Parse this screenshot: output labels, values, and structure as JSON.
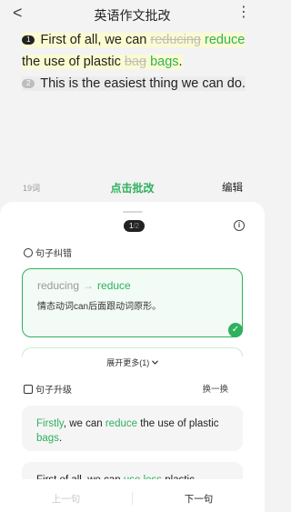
{
  "nav": {
    "back_glyph": "<",
    "title": "英语作文批改",
    "more_glyph": "⋮"
  },
  "essay": {
    "s1_num": "1",
    "s1_a": "First of all, we can ",
    "s1_del1": "reducing",
    "s1_ins1": "reduce",
    "s1_b": " the use of plastic ",
    "s1_del2": "bag",
    "s1_ins2": "bags",
    "s1_c": ".",
    "s2_num": "2",
    "s2_text": "This is the easiest thing we can do."
  },
  "bar": {
    "word_count": "19词",
    "check_label": "点击批改",
    "edit_label": "编辑"
  },
  "sheet": {
    "page_current": "1",
    "page_total": "/2",
    "info_glyph": "i",
    "section_correction": "句子纠错",
    "correction": {
      "from": "reducing",
      "arrow": "→",
      "to": "reduce",
      "explanation": "情态动词can后面跟动词原形。",
      "tick": "✓"
    },
    "expand_label": "展开更多(1)",
    "expand_icon": "chevron-down-icon",
    "section_upgrade": "句子升级",
    "swap_label": "换一换",
    "upgrade1": {
      "p1": "Firstly",
      "p2": ", we can ",
      "p3": "reduce",
      "p4": " the use of plastic ",
      "p5": "bags",
      "p6": "."
    },
    "upgrade2": {
      "p1": "First of all, we can ",
      "p2": "use less",
      "p3": " plastic"
    }
  },
  "footer": {
    "prev_label": "上一句",
    "next_label": "下一句"
  },
  "colors": {
    "accent": "#2eb15d",
    "highlight": "#fbfbd0",
    "deleted": "#bdbdbd"
  }
}
